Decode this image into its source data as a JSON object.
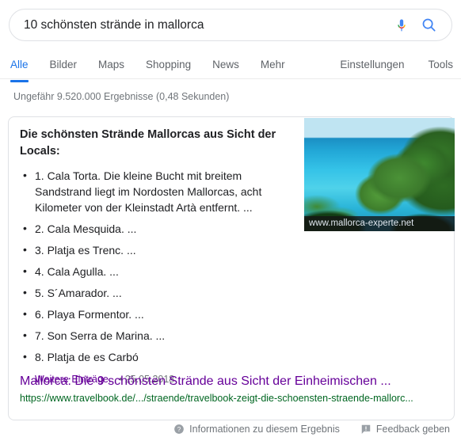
{
  "search": {
    "query": "10 schönsten strände in mallorca",
    "placeholder": "",
    "mic_icon": "microphone-icon",
    "search_icon": "magnifier-icon"
  },
  "nav": {
    "left_tabs": [
      {
        "label": "Alle",
        "active": true
      },
      {
        "label": "Bilder",
        "active": false
      },
      {
        "label": "Maps",
        "active": false
      },
      {
        "label": "Shopping",
        "active": false
      },
      {
        "label": "News",
        "active": false
      },
      {
        "label": "Mehr",
        "active": false
      }
    ],
    "right_tabs": [
      {
        "label": "Einstellungen"
      },
      {
        "label": "Tools"
      }
    ]
  },
  "stats": "Ungefähr 9.520.000 Ergebnisse (0,48 Sekunden)",
  "featured_snippet": {
    "title": "Die schönsten Strände Mallorcas aus Sicht der Locals:",
    "items": [
      "1. Cala Torta. Die kleine Bucht mit breitem Sandstrand liegt im Nordosten Mallorcas, acht Kilometer von der Kleinstadt Artà entfernt. ...",
      "2. Cala Mesquida. ...",
      "3. Platja es Trenc. ...",
      "4. Cala Agulla. ...",
      "5. S´Amarador. ...",
      "6. Playa Formentor. ...",
      "7. Son Serra de Marina. ...",
      "8. Platja de es Carbó"
    ],
    "more_label": "Weitere Einträge...",
    "separator": "•",
    "date": "25.05.2018",
    "thumbnail_caption": "www.mallorca-experte.net"
  },
  "result": {
    "title": "Mallorca: Die 9 schönsten Strände aus Sicht der Einheimischen ...",
    "url": "https://www.travelbook.de/.../straende/travelbook-zeigt-die-schoensten-straende-mallorc..."
  },
  "footer": {
    "info_label": "Informationen zu diesem Ergebnis",
    "info_icon": "help-circle-icon",
    "feedback_label": "Feedback geben",
    "feedback_icon": "feedback-flag-icon"
  },
  "colors": {
    "accent_blue": "#1a73e8",
    "visited_link": "#660099",
    "url_green": "#006621",
    "text_gray": "#70757a",
    "border_gray": "#dfe1e5"
  }
}
